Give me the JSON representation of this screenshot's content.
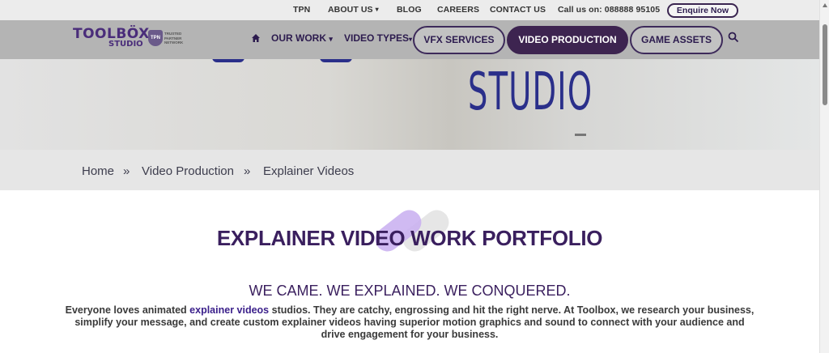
{
  "topbar": {
    "tpn": "TPN",
    "about": "ABOUT US",
    "blog": "BLOG",
    "careers": "CAREERS",
    "contact": "CONTACT US",
    "phone": "Call us on: 088888 95105",
    "enquire": "Enquire Now"
  },
  "logo": {
    "line1": "TOOLBÖX",
    "line2": "STUDIO",
    "badge_short": "TPN",
    "badge_text": "TRUSTED PARTNER NETWORK"
  },
  "nav": {
    "our_work": "OUR WORK",
    "video_types": "VIDEO TYPES",
    "vfx": "VFX SERVICES",
    "video_production": "VIDEO PRODUCTION",
    "game_assets": "GAME ASSETS"
  },
  "hero": {
    "sign_text": "STUDIO"
  },
  "breadcrumb": {
    "home": "Home",
    "sep": "»",
    "level1": "Video Production",
    "level2": "Explainer Videos"
  },
  "content": {
    "title": "EXPLAINER VIDEO WORK PORTFOLIO",
    "subtitle": "WE CAME. WE EXPLAINED. WE CONQUERED.",
    "para_before": "Everyone loves animated ",
    "para_link": "explainer videos",
    "para_after": " studios. They are catchy, engrossing and hit the right nerve. At Toolbox, we research your business, simplify your message, and create custom explainer videos having superior motion graphics and sound to connect with your audience and drive engagement for your business."
  },
  "colors": {
    "brand": "#3a1f5e",
    "active_pill": "#3d2450",
    "nav_bg": "#b4b4b4",
    "accent_lavender": "#c8aef0"
  }
}
